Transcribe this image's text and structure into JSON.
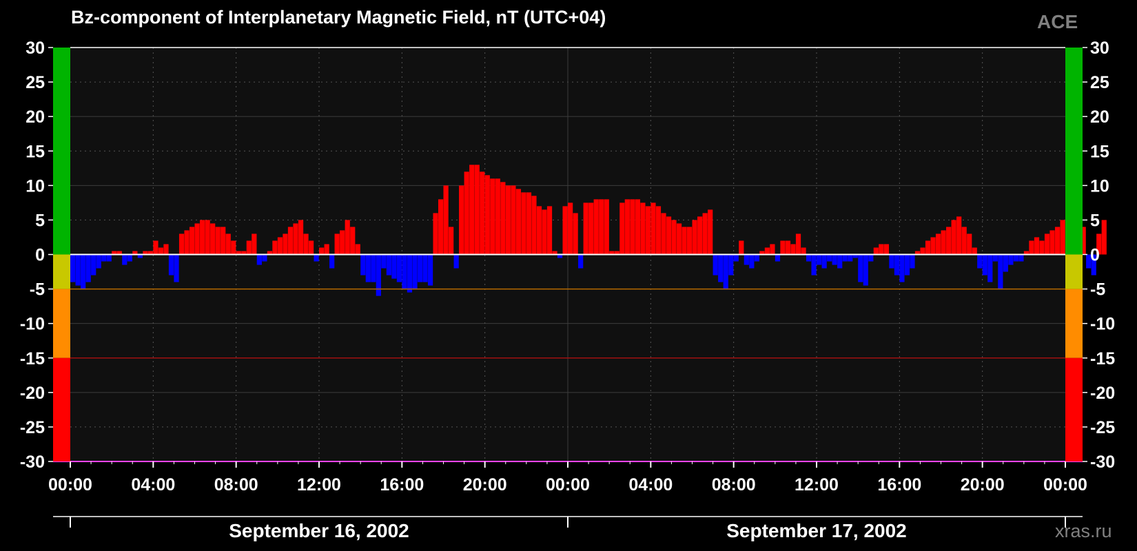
{
  "chart_data": {
    "type": "bar",
    "title": "Bz-component of Interplanetary Magnetic Field, nT (UTC+04)",
    "badge": "ACE",
    "credit": "xras.ru",
    "ylim": [
      -30,
      30
    ],
    "yticks": [
      30,
      25,
      20,
      15,
      10,
      5,
      0,
      -5,
      -10,
      -15,
      -20,
      -25,
      -30
    ],
    "xlim_hours": [
      0,
      48
    ],
    "xticks": [
      {
        "hour": 0,
        "label": "00:00"
      },
      {
        "hour": 4,
        "label": "04:00"
      },
      {
        "hour": 8,
        "label": "08:00"
      },
      {
        "hour": 12,
        "label": "12:00"
      },
      {
        "hour": 16,
        "label": "16:00"
      },
      {
        "hour": 20,
        "label": "20:00"
      },
      {
        "hour": 24,
        "label": "00:00"
      },
      {
        "hour": 28,
        "label": "04:00"
      },
      {
        "hour": 32,
        "label": "08:00"
      },
      {
        "hour": 36,
        "label": "12:00"
      },
      {
        "hour": 40,
        "label": "16:00"
      },
      {
        "hour": 44,
        "label": "20:00"
      },
      {
        "hour": 48,
        "label": "00:00"
      }
    ],
    "dates": [
      {
        "label": "September 16, 2002",
        "start_hour": 0,
        "end_hour": 24
      },
      {
        "label": "September 17, 2002",
        "start_hour": 24,
        "end_hour": 48
      }
    ],
    "grid": true,
    "threshold_lines": [
      {
        "value": -5,
        "color": "#b86a00"
      },
      {
        "value": -15,
        "color": "#a01010"
      }
    ],
    "level_bands": [
      {
        "from": 0,
        "to": 30,
        "color": "#00b400"
      },
      {
        "from": -5,
        "to": 0,
        "color": "#c8c800"
      },
      {
        "from": -15,
        "to": -5,
        "color": "#ff8c00"
      },
      {
        "from": -30,
        "to": -15,
        "color": "#ff0000"
      }
    ],
    "positive_color": "#ff0000",
    "negative_color": "#0000ff",
    "series": [
      {
        "x_start_hour": 0,
        "x_step_hours": 0.25,
        "values": [
          -4,
          -4.5,
          -5,
          -4,
          -3,
          -2,
          -1,
          -1,
          0.5,
          0.5,
          -1.5,
          -1,
          0.5,
          -0.5,
          0.5,
          0.5,
          2,
          1,
          1.5,
          -3,
          -4,
          3,
          3.5,
          4,
          4.5,
          5,
          5,
          4.5,
          4,
          4,
          3,
          2,
          0.5,
          0.5,
          2,
          3,
          -1.5,
          -1,
          0.5,
          2,
          2.5,
          3,
          4,
          4.5,
          5,
          3,
          2,
          -1,
          1,
          1.5,
          -2,
          3,
          3.5,
          5,
          4,
          1.5,
          -3,
          -4,
          -4,
          -6,
          -2,
          -3,
          -3.5,
          -4,
          -5,
          -5.5,
          -5,
          -4,
          -4,
          -4.5,
          6,
          8,
          10,
          4,
          -2,
          10,
          12,
          13,
          13,
          12,
          11.5,
          11,
          11,
          10.5,
          10,
          10,
          9.5,
          9,
          9,
          8.5,
          7,
          6.5,
          7,
          0.5,
          -0.5,
          7,
          7.5,
          6,
          -2,
          7.5,
          7.5,
          8,
          8,
          8,
          0.5,
          0.5,
          7.5,
          8,
          8,
          8,
          7.5,
          7,
          7.5,
          7,
          6,
          5.5,
          5,
          4.5,
          4,
          4,
          5,
          5.5,
          6,
          6.5,
          -3,
          -4,
          -5,
          -3,
          -1,
          2,
          -1.5,
          -2,
          -1,
          0.5,
          1,
          1.5,
          -1,
          2,
          2,
          1.5,
          3,
          1,
          -1,
          -3,
          -1.5,
          -2,
          -1,
          -1.5,
          -2,
          -1,
          -1,
          -0.5,
          -4,
          -4.5,
          -1,
          1,
          1.5,
          1.5,
          -2,
          -3,
          -4,
          -3,
          -2,
          0.5,
          1,
          2,
          2.5,
          3,
          3.5,
          4,
          5,
          5.5,
          4,
          3,
          1,
          -2,
          -3,
          -4,
          -1,
          -5,
          -2.5,
          -1.5,
          -1,
          -1,
          0.5,
          2,
          2.5,
          2,
          3,
          3.5,
          4,
          5,
          6,
          6.5,
          5,
          4,
          -2,
          -3,
          3,
          5
        ]
      }
    ]
  }
}
